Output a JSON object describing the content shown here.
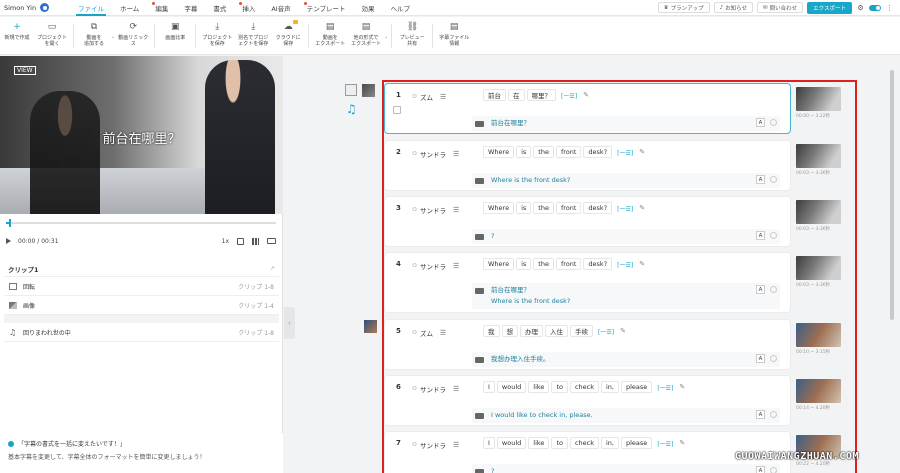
{
  "user": {
    "name": "Simon Yin"
  },
  "menus": [
    {
      "label": "ファイル",
      "active": true,
      "dot": false
    },
    {
      "label": "ホーム",
      "active": false,
      "dot": false
    },
    {
      "label": "編集",
      "active": false,
      "dot": true
    },
    {
      "label": "字幕",
      "active": false,
      "dot": false
    },
    {
      "label": "書式",
      "active": false,
      "dot": false
    },
    {
      "label": "挿入",
      "active": false,
      "dot": true
    },
    {
      "label": "AI音声",
      "active": false,
      "dot": false
    },
    {
      "label": "テンプレート",
      "active": false,
      "dot": true
    },
    {
      "label": "効果",
      "active": false,
      "dot": false
    },
    {
      "label": "ヘルプ",
      "active": false,
      "dot": false
    }
  ],
  "top_actions": {
    "plan": "プランアップ",
    "notice": "お知らせ",
    "contact": "問い合わせ",
    "export": "エクスポート"
  },
  "toolbar": [
    {
      "label": "新規で作成",
      "icon": "+"
    },
    {
      "label": "プロジェクト\nを開く",
      "icon": "▭"
    },
    {
      "label": "動画を\n追加する",
      "icon": "⧉"
    },
    {
      "label": "動画リミック\nス",
      "icon": "⟳"
    },
    {
      "label": "画面比率",
      "icon": "▣"
    },
    {
      "label": "プロジェクト\nを保存",
      "icon": "⤓"
    },
    {
      "label": "別名でプロジ\nェクトを保存",
      "icon": "⤓"
    },
    {
      "label": "クラウドに\n保存",
      "icon": "☁"
    },
    {
      "label": "動画を\nエクスポート",
      "icon": "▤"
    },
    {
      "label": "他の形式で\nエクスポート",
      "icon": "▤"
    },
    {
      "label": "プレビュー\n共有",
      "icon": "⛓"
    },
    {
      "label": "字幕ファイル\n情報",
      "icon": "▤"
    }
  ],
  "player": {
    "logo": "VIEW",
    "subtitle": "前台在哪里？",
    "current_time": "00:00",
    "total_time": "/ 00:31",
    "speed": "1x",
    "progress": 0.01
  },
  "clips": {
    "title": "クリップ1",
    "items": [
      {
        "icon": "video",
        "label": "回転",
        "range": "クリップ 1-8"
      },
      {
        "icon": "image",
        "label": "画像",
        "range": "クリップ 1-4"
      },
      {
        "icon": "music",
        "label": "回りまわれ世の中",
        "range": "クリップ 1-8"
      }
    ]
  },
  "tip": {
    "title": "「字幕の書式を一括に変えたいです！」",
    "body": "基本字幕を変更して、字幕全体のフォーマットを簡単に変更しましょう！"
  },
  "rows": [
    {
      "num": "1",
      "speaker": "ズム",
      "tokens": [
        "前台",
        "在",
        "哪里？"
      ],
      "translation": [
        "前台在哪里？"
      ],
      "time": "00:00 ~ 3.22秒",
      "selected": true,
      "thumb": "office"
    },
    {
      "num": "2",
      "speaker": "サンドラ",
      "tokens": [
        "Where",
        "is",
        "the",
        "front",
        "desk?"
      ],
      "translation": [
        "Where is the front desk?"
      ],
      "time": "00:03 ~ 3.36秒",
      "selected": false,
      "thumb": "office"
    },
    {
      "num": "3",
      "speaker": "サンドラ",
      "tokens": [
        "Where",
        "is",
        "the",
        "front",
        "desk?"
      ],
      "translation": [
        "?"
      ],
      "time": "00:03 ~ 3.36秒",
      "selected": false,
      "thumb": "office"
    },
    {
      "num": "4",
      "speaker": "サンドラ",
      "tokens": [
        "Where",
        "is",
        "the",
        "front",
        "desk?"
      ],
      "translation": [
        "前台在哪里？",
        "Where is the front desk?"
      ],
      "time": "00:03 ~ 3.36秒",
      "selected": false,
      "thumb": "office"
    },
    {
      "num": "5",
      "speaker": "ズム",
      "tokens": [
        "我",
        "想",
        "办理",
        "入住",
        "手续"
      ],
      "translation": [
        "我想办理入住手续。"
      ],
      "time": "00:10 ~ 3.15秒",
      "selected": false,
      "thumb": "lobby"
    },
    {
      "num": "6",
      "speaker": "サンドラ",
      "tokens": [
        "I",
        "would",
        "like",
        "to",
        "check",
        "in,",
        "please"
      ],
      "translation": [
        "I would like to check in, please."
      ],
      "time": "00:14 ~ 4.20秒",
      "selected": false,
      "thumb": "lobby"
    },
    {
      "num": "7",
      "speaker": "サンドラ",
      "tokens": [
        "I",
        "would",
        "like",
        "to",
        "check",
        "in,",
        "please"
      ],
      "translation": [
        "?"
      ],
      "time": "00:22 ~ 4.20秒",
      "selected": false,
      "thumb": "lobby"
    }
  ],
  "token_add": "[一☰]",
  "a_button": "A",
  "watermark": "GUOWAIWANGZHUAN.COM"
}
